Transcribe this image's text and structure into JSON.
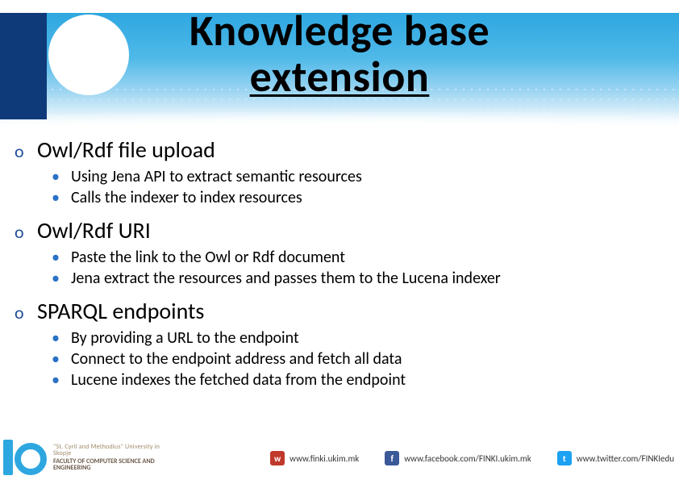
{
  "title": {
    "line1": "Knowledge base",
    "line2": "extension"
  },
  "sections": [
    {
      "heading": "Owl/Rdf file upload",
      "items": [
        "Using Jena API to extract semantic resources",
        "Calls the indexer to index resources"
      ]
    },
    {
      "heading": "Owl/Rdf URI",
      "items": [
        "Paste the link to the Owl or Rdf document",
        "Jena extract the resources and passes them to the Lucena indexer"
      ]
    },
    {
      "heading": "SPARQL endpoints",
      "items": [
        "By providing a URL to the endpoint",
        "Connect to the endpoint address and fetch all data",
        "Lucene indexes the fetched data from the endpoint"
      ]
    }
  ],
  "footer": {
    "university": "\"St. Cyril and Methodius\" University in Skopje",
    "faculty": "FACULTY OF COMPUTER SCIENCE AND ENGINEERING",
    "links": {
      "web": "www.finki.ukim.mk",
      "facebook": "www.facebook.com/FINKI.ukim.mk",
      "twitter": "www.twitter.com/FINKIedu"
    },
    "icons": {
      "web": "w",
      "facebook": "f",
      "twitter": "t"
    }
  }
}
